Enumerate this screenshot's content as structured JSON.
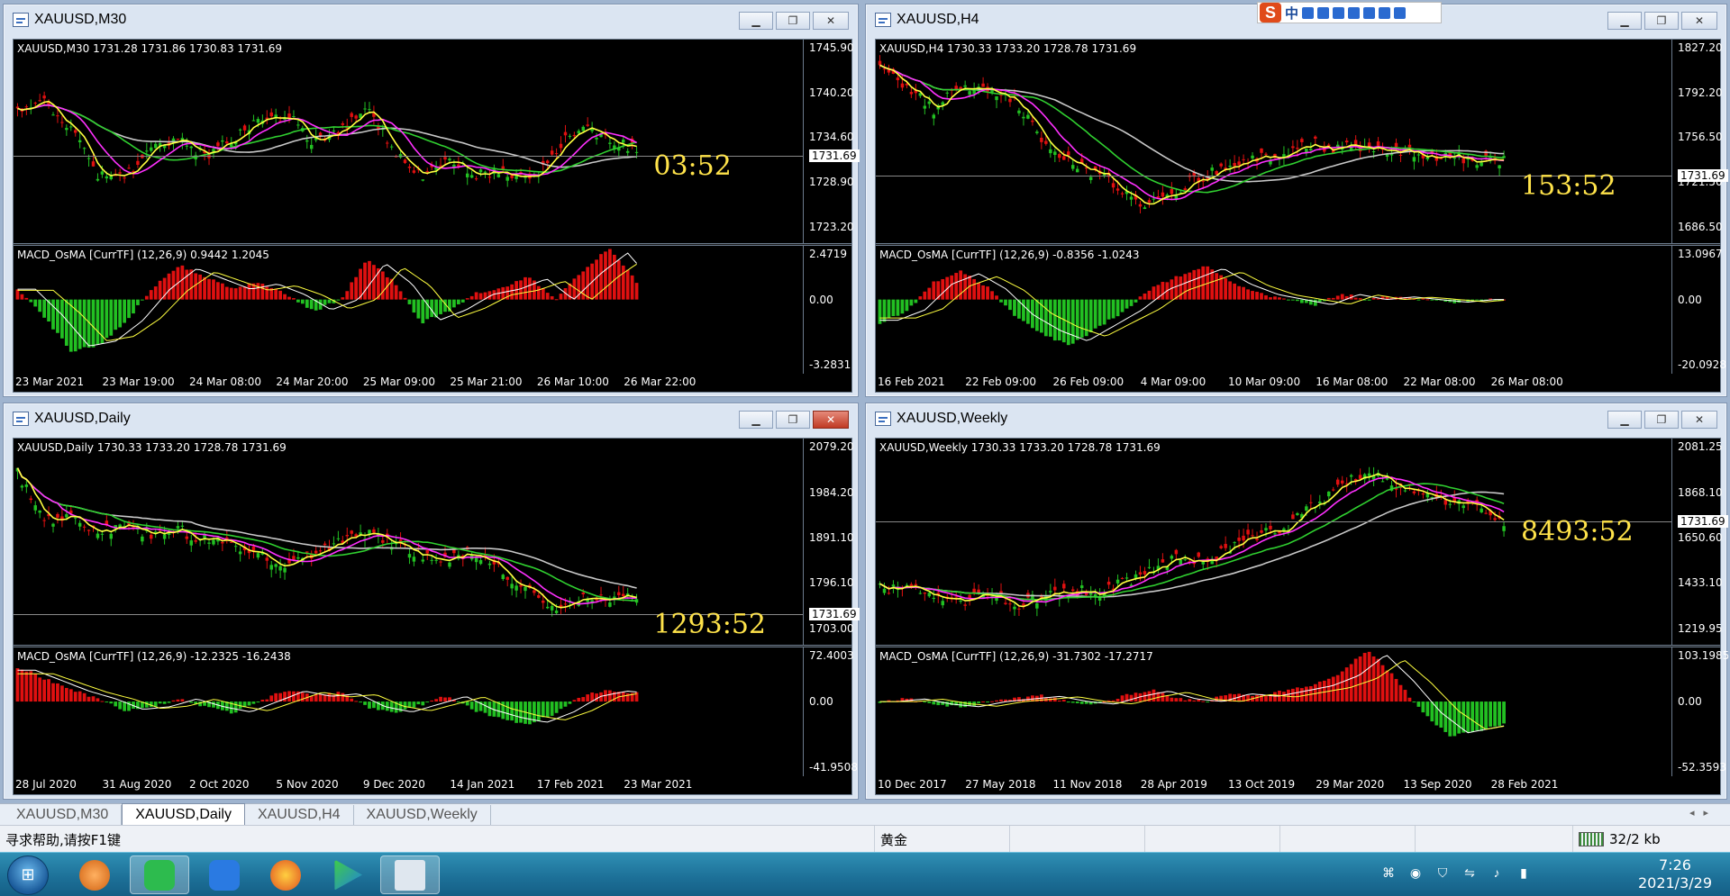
{
  "ime_bar": {
    "logo": "S",
    "mode": "中"
  },
  "windows": [
    {
      "id": "m30",
      "title": "XAUUSD,M30",
      "price_label": "XAUUSD,M30  1731.28 1731.86 1730.83 1731.69",
      "price_axis": [
        "1745.90",
        "1740.20",
        "1734.60",
        "1728.90",
        "1723.20"
      ],
      "current_price": "1731.69",
      "countdown": "03:52",
      "macd_label": "MACD_OsMA [CurrTF] (12,26,9) 0.9442 1.2045",
      "macd_axis": [
        "2.4719",
        "0.00",
        "-3.2831"
      ],
      "time_axis": [
        "23 Mar 2021",
        "23 Mar 19:00",
        "24 Mar 08:00",
        "24 Mar 20:00",
        "25 Mar 09:00",
        "25 Mar 21:00",
        "26 Mar 10:00",
        "26 Mar 22:00"
      ],
      "close_red": false
    },
    {
      "id": "h4",
      "title": "XAUUSD,H4",
      "price_label": "XAUUSD,H4  1730.33 1733.20 1728.78 1731.69",
      "price_axis": [
        "1827.20",
        "1792.20",
        "1756.50",
        "1721.50",
        "1686.50"
      ],
      "current_price": "1731.69",
      "countdown": "153:52",
      "macd_label": "MACD_OsMA [CurrTF] (12,26,9) -0.8356 -1.0243",
      "macd_axis": [
        "13.0967",
        "0.00",
        "-20.0928"
      ],
      "time_axis": [
        "16 Feb 2021",
        "22 Feb 09:00",
        "26 Feb 09:00",
        "4 Mar 09:00",
        "10 Mar 09:00",
        "16 Mar 08:00",
        "22 Mar 08:00",
        "26 Mar 08:00"
      ],
      "close_red": false
    },
    {
      "id": "daily",
      "title": "XAUUSD,Daily",
      "price_label": "XAUUSD,Daily  1730.33 1733.20 1728.78 1731.69",
      "price_axis": [
        "2079.20",
        "1984.20",
        "1891.10",
        "1796.10",
        "1703.00"
      ],
      "current_price": "1731.69",
      "countdown": "1293:52",
      "macd_label": "MACD_OsMA [CurrTF] (12,26,9) -12.2325 -16.2438",
      "macd_axis": [
        "72.4003",
        "0.00",
        "-41.9508"
      ],
      "time_axis": [
        "28 Jul 2020",
        "31 Aug 2020",
        "2 Oct 2020",
        "5 Nov 2020",
        "9 Dec 2020",
        "14 Jan 2021",
        "17 Feb 2021",
        "23 Mar 2021"
      ],
      "close_red": true
    },
    {
      "id": "weekly",
      "title": "XAUUSD,Weekly",
      "price_label": "XAUUSD,Weekly  1730.33 1733.20 1728.78 1731.69",
      "price_axis": [
        "2081.25",
        "1868.10",
        "1650.60",
        "1433.10",
        "1219.95"
      ],
      "current_price": "1731.69",
      "countdown": "8493:52",
      "macd_label": "MACD_OsMA [CurrTF] (12,26,9) -31.7302 -17.2717",
      "macd_axis": [
        "103.1985",
        "0.00",
        "-52.3593"
      ],
      "time_axis": [
        "10 Dec 2017",
        "27 May 2018",
        "11 Nov 2018",
        "28 Apr 2019",
        "13 Oct 2019",
        "29 Mar 2020",
        "13 Sep 2020",
        "28 Feb 2021"
      ],
      "close_red": false
    }
  ],
  "tabs": [
    "XAUUSD,M30",
    "XAUUSD,Daily",
    "XAUUSD,H4",
    "XAUUSD,Weekly"
  ],
  "active_tab": "XAUUSD,Daily",
  "status": {
    "help": "寻求帮助,请按F1键",
    "symbol": "黄金",
    "traffic": "32/2 kb"
  },
  "clock": {
    "time": "7:26",
    "date": "2021/3/29"
  },
  "colors": {
    "bull": "#22c022",
    "bear": "#e01010",
    "ma_fast": "#ffff40",
    "ma_mid": "#ff30ff",
    "ma_slow": "#30d030",
    "ma_long": "#c8c8c8",
    "countdown": "#ffe34a"
  }
}
